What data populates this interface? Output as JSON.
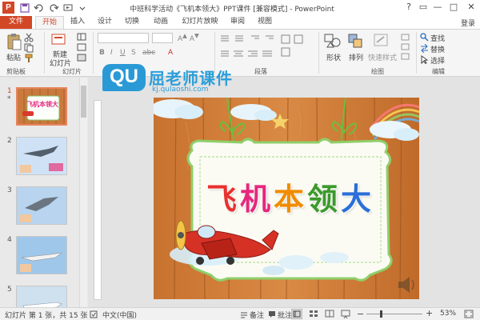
{
  "window": {
    "title": "中班科学活动《飞机本领大》PPT课件 [兼容模式] - PowerPoint",
    "app_icon_letter": "P",
    "controls": [
      "?",
      "▭",
      "—",
      "□",
      "✕"
    ]
  },
  "tabs": {
    "file": "文件",
    "items": [
      "开始",
      "插入",
      "设计",
      "切换",
      "动画",
      "幻灯片放映",
      "审阅",
      "视图"
    ],
    "login": "登录"
  },
  "ribbon": {
    "clipboard": {
      "paste": "粘贴",
      "label": "剪贴板"
    },
    "slides": {
      "new_slide_line1": "新建",
      "new_slide_line2": "幻灯片",
      "label": "幻灯片"
    },
    "paragraph": {
      "label": "段落"
    },
    "drawing": {
      "shapes": "形状",
      "arrange": "排列",
      "quick_styles": "快速样式",
      "label": "绘图"
    },
    "editing": {
      "find": "查找",
      "replace": "替换",
      "select": "选择",
      "label": "编辑"
    }
  },
  "watermark": {
    "badge": "QU",
    "cn_text": "屈老师课件",
    "url": "kj.qulaoshi.com"
  },
  "thumbnails": [
    {
      "number": "1",
      "star": "*",
      "title": "飞机本领大",
      "selected": true
    },
    {
      "number": "2"
    },
    {
      "number": "3"
    },
    {
      "number": "4"
    },
    {
      "number": "5"
    }
  ],
  "slide": {
    "title": "飞机本领大",
    "title_colors": [
      "#e8312f",
      "#e5287e",
      "#f08c00",
      "#3a9a2a",
      "#2b6fd8"
    ]
  },
  "status": {
    "slide_info": "幻灯片 第 1 张，共 15 张",
    "language": "中文(中国)",
    "notes": "备注",
    "comments": "批注",
    "zoom": "53%",
    "zoom_fraction": 0.53
  },
  "colors": {
    "accent": "#d24726",
    "ribbon_bg": "#f5f5f5"
  }
}
